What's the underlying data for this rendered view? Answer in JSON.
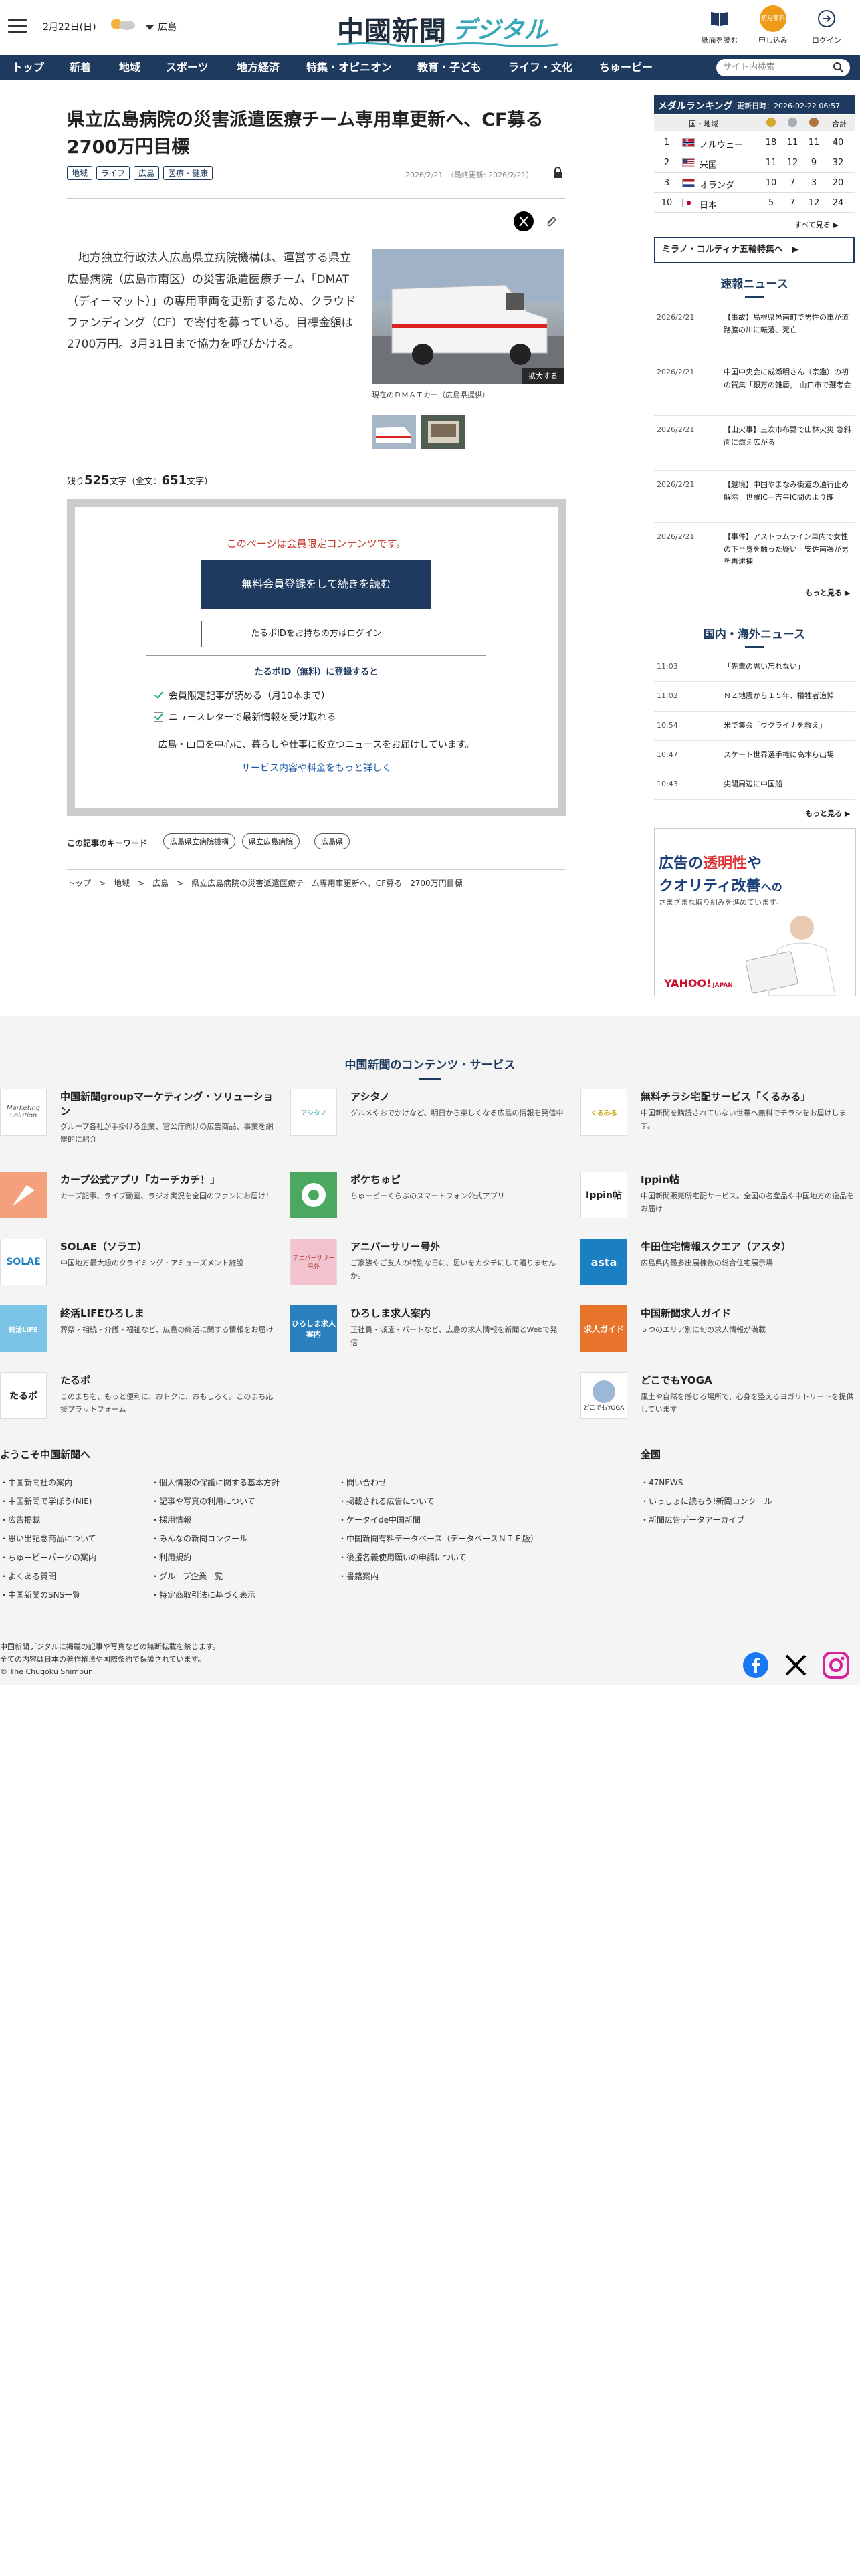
{
  "header": {
    "date": "2月22日(日)",
    "region": "広島",
    "logo_kanji": "中國新聞",
    "logo_digital": "デジタル",
    "icons": [
      {
        "name": "paper-icon",
        "label": "紙面を読む"
      },
      {
        "name": "register-icon",
        "label": "申し込み",
        "badge": "初月無料"
      },
      {
        "name": "login-icon",
        "label": "ログイン"
      }
    ]
  },
  "nav": {
    "items": [
      "トップ",
      "新着",
      "地域",
      "スポーツ",
      "地方経済",
      "特集・オピニオン",
      "教育・子ども",
      "ライフ・文化",
      "ちゅーピー"
    ],
    "search_placeholder": "サイト内検索"
  },
  "article": {
    "title": "県立広島病院の災害派遣医療チーム専用車更新へ、CF募る　2700万円目標",
    "tags": [
      "地域",
      "ライフ",
      "広島",
      "医療・健康"
    ],
    "pubdate": "2026/2/21　（最終更新: 2026/2/21）",
    "body": "　地方独立行政法人広島県立病院機構は、運営する県立広島病院（広島市南区）の災害派遣医療チーム「DMAT（ディーマット）」の専用車両を更新するため、クラウドファンディング（CF）で寄付を募っている。目標金額は2700万円。3月31日まで協力を呼びかける。",
    "photo_enlarge": "拡大する",
    "photo_caption": "現在のＤＭＡＴカー（広島県提供）",
    "remain_prefix": "残り",
    "remain_count": "525",
    "remain_mid": "文字（全文：",
    "total_count": "651",
    "remain_suffix": "文字）"
  },
  "paywall": {
    "message": "このページは会員限定コンテンツです。",
    "register_button": "無料会員登録をして続きを読む",
    "login_button": "たるポIDをお持ちの方はログイン",
    "heading": "たるポID（無料）に登録すると",
    "benefits": [
      "会員限定記事が読める（月10本まで）",
      "ニュースレターで最新情報を受け取れる"
    ],
    "description": "広島・山口を中心に、暮らしや仕事に役立つニュースをお届けしています。",
    "link": "サービス内容や料金をもっと詳しく"
  },
  "keywords": {
    "label": "この記事のキーワード",
    "items": [
      "広島県立病院機構",
      "県立広島病院",
      "広島県"
    ]
  },
  "breadcrumb": "トップ　>　地域　>　広島　>　県立広島病院の災害派遣医療チーム専用車更新へ、CF募る　2700万円目標",
  "medals": {
    "title": "メダルランキング",
    "updated": "更新日時：2026-02-22 06:57",
    "col_country": "国・地域",
    "col_total": "合計",
    "rows": [
      {
        "rank": "1",
        "country": "ノルウェー",
        "gold": "18",
        "silver": "11",
        "bronze": "11",
        "total": "40"
      },
      {
        "rank": "2",
        "country": "米国",
        "gold": "11",
        "silver": "12",
        "bronze": "9",
        "total": "32"
      },
      {
        "rank": "3",
        "country": "オランダ",
        "gold": "10",
        "silver": "7",
        "bronze": "3",
        "total": "20"
      },
      {
        "rank": "10",
        "country": "日本",
        "gold": "5",
        "silver": "7",
        "bronze": "12",
        "total": "24"
      }
    ],
    "see_all": "すべて見る ▶",
    "special": "ミラノ・コルティナ五輪特集へ　▶"
  },
  "breaking": {
    "title": "速報ニュース",
    "items": [
      {
        "date": "2026/2/21",
        "headline": "【事故】島根県邑南町で男性の車が道路脇の川に転落、死亡"
      },
      {
        "date": "2026/2/21",
        "headline": "中国中央会に成瀬明さん（宗鑑）の初の賀集「銀万の雑唇」 山口市で選考会"
      },
      {
        "date": "2026/2/21",
        "headline": "【山火事】三次市布野で山林火災 急斜面に燃え広がる"
      },
      {
        "date": "2026/2/21",
        "headline": "【越境】中国やまなみ街道の通行止め解除　世羅IC—吉舎IC間のより確"
      },
      {
        "date": "2026/2/21",
        "headline": "【事件】アストラムライン車内で女性の下半身を触った疑い　安佐南署が男を再逮捕"
      }
    ],
    "more": "もっと見る ▶"
  },
  "world": {
    "title": "国内・海外ニュース",
    "items": [
      {
        "date": "11:03",
        "headline": "「先輩の思い忘れない」"
      },
      {
        "date": "11:02",
        "headline": "ＮＺ地震から１５年、犠牲者追悼"
      },
      {
        "date": "10:54",
        "headline": "米で集会「ウクライナを救え」"
      },
      {
        "date": "10:47",
        "headline": "スケート世界選手権に高木ら出場"
      },
      {
        "date": "10:43",
        "headline": "尖閣周辺に中国船"
      }
    ],
    "more": "もっと見る ▶"
  },
  "ad": {
    "line1a": "広告の",
    "line1b": "透明性",
    "line1c": "や",
    "line2a": "クオリティ改善",
    "line2b": "への",
    "line3": "さまざまな取り組みを進めています。",
    "brand": "YAHOO!",
    "brand_sub": "JAPAN"
  },
  "footer": {
    "contents_title": "中国新聞のコンテンツ・サービス",
    "services": [
      {
        "name": "中国新聞groupマーケティング・ソリューション",
        "desc": "グループ各社が手掛ける企業、官公庁向けの広告商品、事業を網羅的に紹介",
        "logo": "Marketing Solution"
      },
      {
        "name": "アシタノ",
        "desc": "グルメやおでかけなど、明日から楽しくなる広島の情報を発信中",
        "logo": "アシタノ"
      },
      {
        "name": "無料チラシ宅配サービス「くるみる」",
        "desc": "中国新聞を購読されていない世帯へ無料でチラシをお届けします。",
        "logo": "くるみる"
      },
      {
        "name": "カープ公式アプリ「カーチカチ！」",
        "desc": "カープ記事、ライブ動画、ラジオ実況を全国のファンにお届け！",
        "logo": ""
      },
      {
        "name": "ポケちゅピ",
        "desc": "ちゅーピーくらぶのスマートフォン公式アプリ",
        "logo": ""
      },
      {
        "name": "Ippin帖",
        "desc": "中国新聞販売所宅配サービス。全国の名産品や中国地方の逸品をお届け",
        "logo": "Ippin帖"
      },
      {
        "name": "SOLAE（ソラエ）",
        "desc": "中国地方最大級のクライミング・アミューズメント施設",
        "logo": "SOLAE"
      },
      {
        "name": "アニバーサリー号外",
        "desc": "ご家族やご友人の特別な日に、思いをカタチにして贈りませんか。",
        "logo": "アニバーサリー号外"
      },
      {
        "name": "牛田住宅情報スクエア（アスタ）",
        "desc": "広島県内最多出展棟数の総合住宅展示場",
        "logo": "asta"
      },
      {
        "name": "終活LIFEひろしま",
        "desc": "葬祭・相続・介護・福祉など、広島の終活に関する情報をお届け",
        "logo": "終活LIFE"
      },
      {
        "name": "ひろしま求人案内",
        "desc": "正社員・派遣・パートなど、広島の求人情報を新聞とWebで発信",
        "logo": "ひろしま求人案内"
      },
      {
        "name": "中国新聞求人ガイド",
        "desc": "５つのエリア別に旬の求人情報が満載",
        "logo": "求人ガイド"
      },
      {
        "name": "たるポ",
        "desc": "このまちを、もっと便利に、おトクに、おもしろく。このまち応援プラットフォーム",
        "logo": "たるポ"
      },
      {
        "name": "どこでもYOGA",
        "desc": "風土や自然を感じる場所で、心身を整えるヨガリトリートを提供しています",
        "logo": "どこでもYOGA"
      }
    ],
    "welcome_title": "ようこそ中国新聞へ",
    "all_title": "全国",
    "col1": [
      "中国新聞社の案内",
      "中国新聞で学ぼう(NIE)",
      "広告掲載",
      "思い出記念商品について",
      "ちゅーピーパークの案内",
      "よくある質問",
      "中国新聞のSNS一覧"
    ],
    "col2": [
      "個人情報の保護に関する基本方針",
      "記事や写真の利用について",
      "採用情報",
      "みんなの新聞コンクール",
      "利用規約",
      "グループ企業一覧",
      "特定商取引法に基づく表示"
    ],
    "col3": [
      "問い合わせ",
      "掲載される広告について",
      "ケータイde中国新聞",
      "中国新聞有料データベース（データベースＮＩＥ版）",
      "後援名義使用願いの申請について",
      "書籍案内"
    ],
    "col4": [
      "47NEWS",
      "いっしょに読もう!新聞コンクール",
      "新聞広告データアーカイブ"
    ],
    "copyright_lines": [
      "中国新聞デジタルに掲載の記事や写真などの無断転載を禁じます。",
      "全ての内容は日本の著作権法や国際条約で保護されています。",
      "© The Chugoku Shimbun"
    ]
  }
}
